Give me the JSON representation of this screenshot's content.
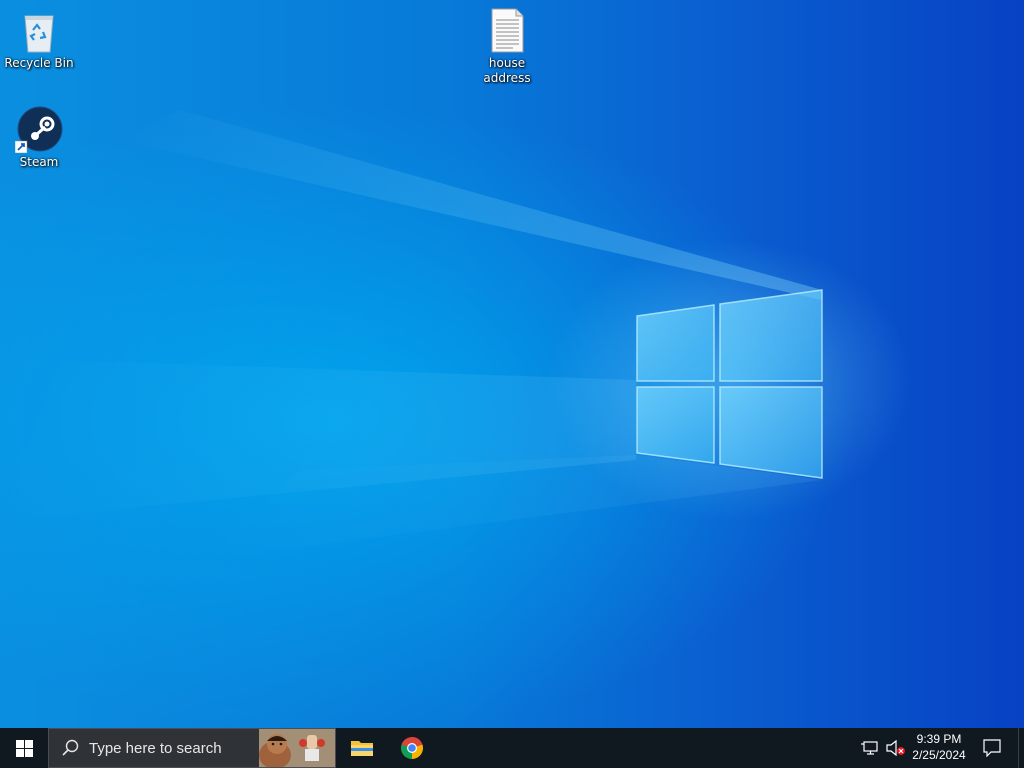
{
  "desktop": {
    "icons": [
      {
        "label": "Recycle Bin",
        "icon": "recycle-bin-icon"
      },
      {
        "label": "Steam",
        "icon": "steam-icon"
      },
      {
        "label": "house address",
        "icon": "text-document-icon"
      }
    ]
  },
  "taskbar": {
    "start_icon": "windows-logo-icon",
    "search_placeholder": "Type here to search",
    "pinned": [
      {
        "name": "File Explorer",
        "icon": "folder-icon"
      },
      {
        "name": "Google Chrome",
        "icon": "chrome-icon"
      }
    ],
    "tray": {
      "network_icon": "network-icon",
      "volume_icon": "volume-muted-icon",
      "time": "9:39 PM",
      "date": "2/25/2024",
      "notifications_icon": "action-center-icon"
    }
  },
  "colors": {
    "wallpaper_base": "#0879d8",
    "taskbar_bg": "#101820",
    "search_bg": "#2f3338"
  }
}
